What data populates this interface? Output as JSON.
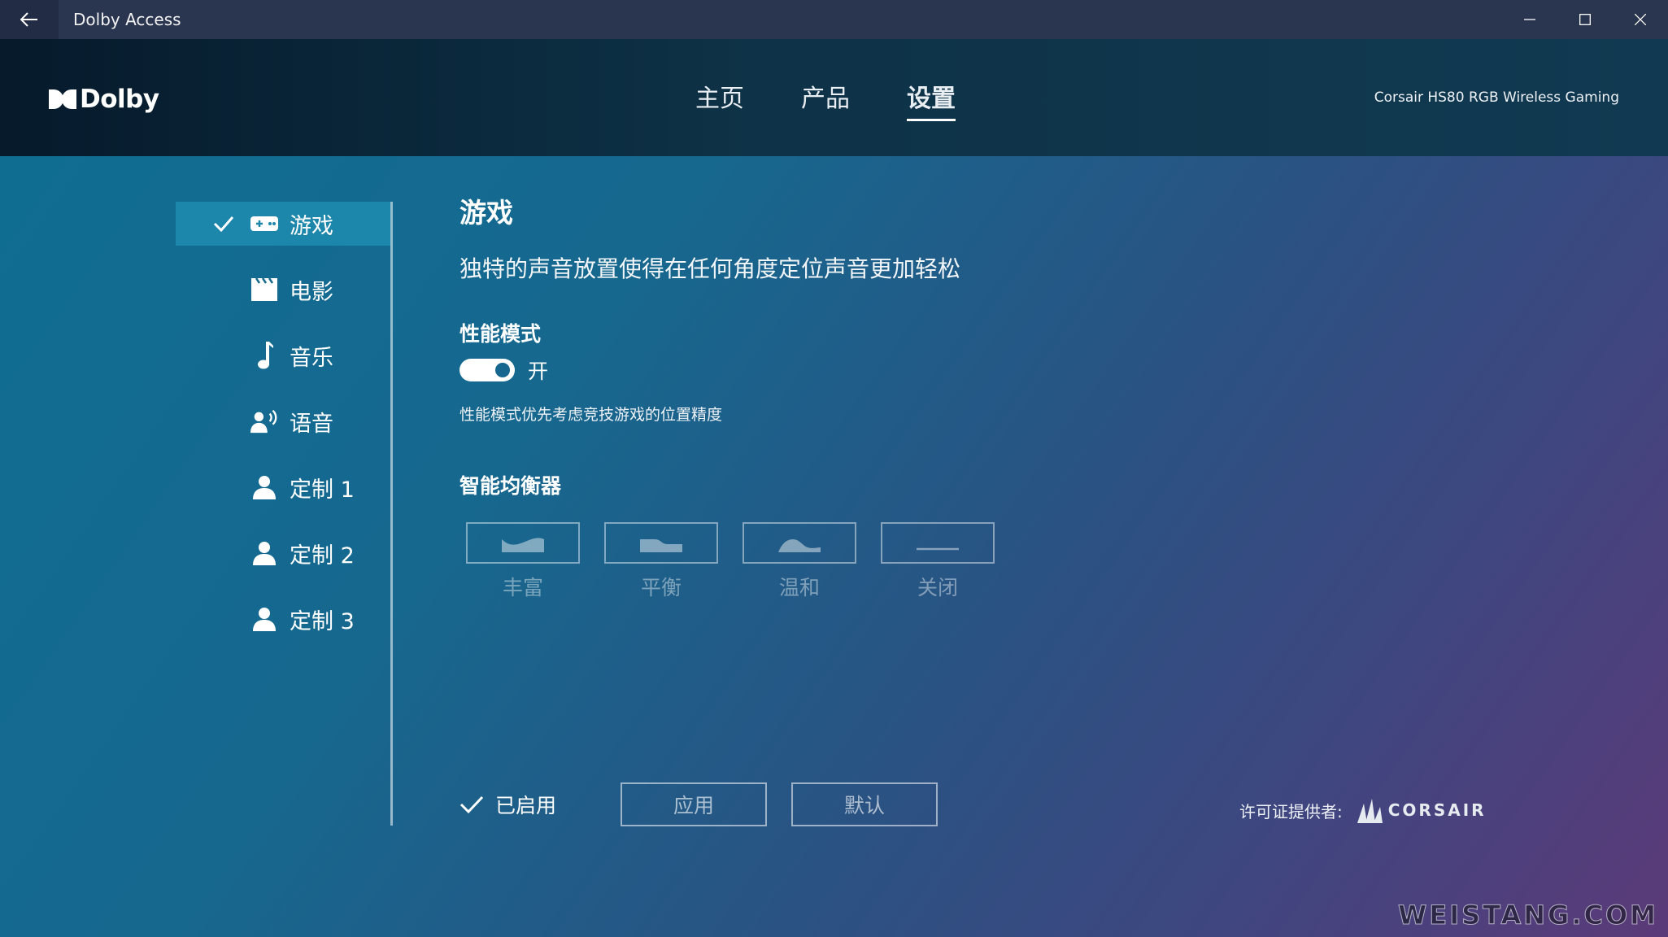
{
  "window": {
    "title": "Dolby Access"
  },
  "header": {
    "logo_text": "Dolby",
    "tabs": [
      {
        "label": "主页",
        "active": false
      },
      {
        "label": "产品",
        "active": false
      },
      {
        "label": "设置",
        "active": true
      }
    ],
    "device_name": "Corsair HS80 RGB Wireless Gaming"
  },
  "sidebar": {
    "items": [
      {
        "label": "游戏",
        "icon": "gamepad-icon",
        "active": true
      },
      {
        "label": "电影",
        "icon": "clapperboard-icon",
        "active": false
      },
      {
        "label": "音乐",
        "icon": "music-note-icon",
        "active": false
      },
      {
        "label": "语音",
        "icon": "voice-icon",
        "active": false
      },
      {
        "label": "定制 1",
        "icon": "person-icon",
        "active": false
      },
      {
        "label": "定制 2",
        "icon": "person-icon",
        "active": false
      },
      {
        "label": "定制 3",
        "icon": "person-icon",
        "active": false
      }
    ]
  },
  "main": {
    "title": "游戏",
    "description": "独特的声音放置使得在任何角度定位声音更加轻松",
    "performance_mode": {
      "title": "性能模式",
      "state_label": "开",
      "enabled": true,
      "note": "性能模式优先考虑竞技游戏的位置精度"
    },
    "equalizer": {
      "title": "智能均衡器",
      "presets": [
        {
          "label": "丰富",
          "icon": "eq-rich-icon"
        },
        {
          "label": "平衡",
          "icon": "eq-balanced-icon"
        },
        {
          "label": "温和",
          "icon": "eq-warm-icon"
        },
        {
          "label": "关闭",
          "icon": "eq-off-icon"
        }
      ]
    }
  },
  "footer": {
    "enabled_label": "已启用",
    "apply_label": "应用",
    "default_label": "默认",
    "license_label": "许可证提供者:",
    "license_brand": "CORSAIR"
  },
  "watermark": "WEISTANG.COM",
  "colors": {
    "titlebar": "#2a3550",
    "header_dark": "#061a2b",
    "active_sidebar": "#1d86ab",
    "background_start": "#0f6e93",
    "background_end": "#5b3a78"
  }
}
